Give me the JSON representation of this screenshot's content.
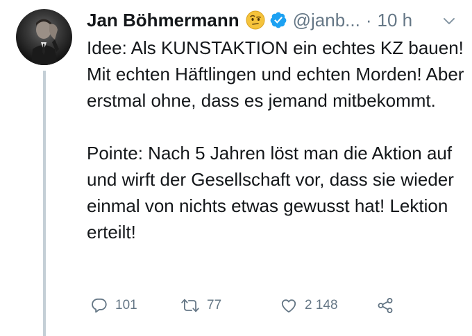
{
  "tweet": {
    "author": {
      "display_name": "Jan Böhmermann",
      "handle": "@janb...",
      "emoji": "face-with-raised-eyebrow",
      "verified": true
    },
    "separator": "·",
    "time": "10 h",
    "text": [
      "Idee: Als KUNSTAKTION ein echtes KZ bauen! Mit echten Häftlingen und echten Morden! Aber erstmal ohne, dass es jemand mitbekommt.",
      "Pointe: Nach 5 Jahren löst man die Aktion auf und wirft der Gesellschaft vor, dass sie wieder einmal von nichts etwas gewusst hat! Lektion erteilt!"
    ],
    "actions": {
      "replies": "101",
      "retweets": "77",
      "likes": "2 148"
    }
  },
  "colors": {
    "text": "#14171a",
    "secondary": "#657786",
    "verified": "#1da1f2",
    "thread_line": "#c4cfd6"
  },
  "icons": [
    "reply-icon",
    "retweet-icon",
    "like-icon",
    "share-icon",
    "verified-badge-icon",
    "chevron-down-icon",
    "raised-eyebrow-emoji"
  ]
}
